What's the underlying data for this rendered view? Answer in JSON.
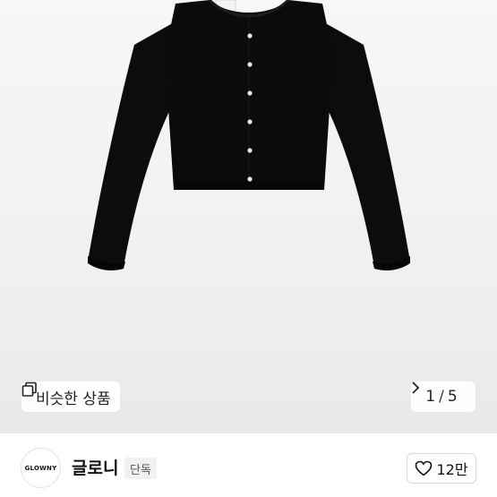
{
  "product": {
    "image_alt_icon": "black-cardigan-image",
    "similar_button_label": "비슷한 상품",
    "gallery": {
      "current": "1",
      "separator": "/",
      "total": "5"
    }
  },
  "brand": {
    "logo_text": "GLOWNY",
    "name": "글로니",
    "badge": "단독"
  },
  "likes": {
    "count_label": "12만"
  },
  "colors": {
    "garment": "#0b0b0b",
    "buttons": "#e8e8e8",
    "background": "#f2f2f2"
  }
}
